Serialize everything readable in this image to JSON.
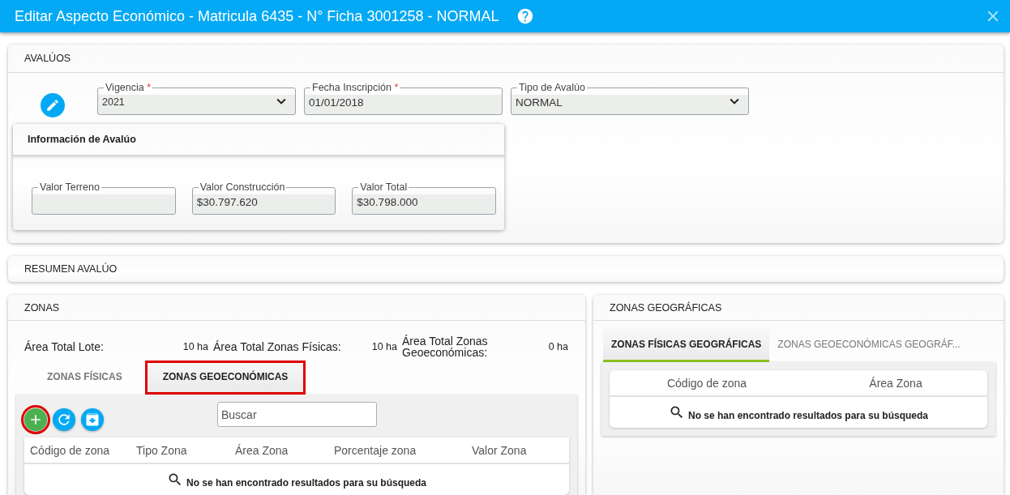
{
  "window": {
    "title": "Editar Aspecto Económico - Matricula 6435 - N° Ficha 3001258 - NORMAL"
  },
  "avaluos": {
    "title": "AVALÚOS",
    "fields": [
      {
        "label": "Vigencia",
        "required_mark": "*",
        "kind": "select",
        "value": "2021"
      },
      {
        "label": "Fecha Inscripción",
        "required_mark": "*",
        "kind": "text",
        "value": "01/01/2018"
      },
      {
        "label": "Tipo de Avalúo",
        "kind": "select",
        "value": "NORMAL"
      }
    ],
    "info": {
      "title": "Información de Avalúo",
      "fields": [
        {
          "label": "Valor Terreno"
        },
        {
          "label": "Valor Construcción",
          "value": "$30.797.620"
        },
        {
          "label": "Valor Total",
          "value": "$30.798.000"
        }
      ]
    }
  },
  "resumen": {
    "title": "RESUMEN AVALÚO"
  },
  "zonas": {
    "title": "ZONAS",
    "totals": [
      {
        "label": "Área Total Lote:",
        "value": "10 ha"
      },
      {
        "label": "Área Total Zonas Físicas:",
        "value": "10 ha"
      },
      {
        "label": "Área Total Zonas Geoeconómicas:",
        "value": "0 ha"
      }
    ],
    "tabs": [
      {
        "label": "ZONAS FÍSICAS",
        "selected": false,
        "highlighted": false
      },
      {
        "label": "ZONAS GEOECONÓMICAS",
        "selected": true,
        "highlighted": true
      }
    ],
    "toolbar": [
      {
        "kind": "add",
        "highlighted": true
      },
      {
        "kind": "refresh",
        "highlighted": false
      },
      {
        "kind": "export",
        "highlighted": false
      }
    ],
    "search": {
      "placeholder": "Buscar"
    },
    "table": {
      "columns": [
        "Código de zona",
        "Tipo Zona",
        "Área Zona",
        "Porcentaje zona",
        "Valor Zona"
      ],
      "empty_message": "No se han encontrado resultados para su búsqueda"
    }
  },
  "zonas_geograficas": {
    "title": "ZONAS GEOGRÁFICAS",
    "tabs": [
      {
        "label": "ZONAS FÍSICAS GEOGRÁFICAS",
        "selected": true
      },
      {
        "label": "ZONAS GEOECONÓMICAS GEOGRÁF...",
        "selected": false
      }
    ],
    "table": {
      "columns": [
        "Código de zona",
        "Área Zona"
      ],
      "empty_message": "No se han encontrado resultados para su búsqueda"
    }
  }
}
